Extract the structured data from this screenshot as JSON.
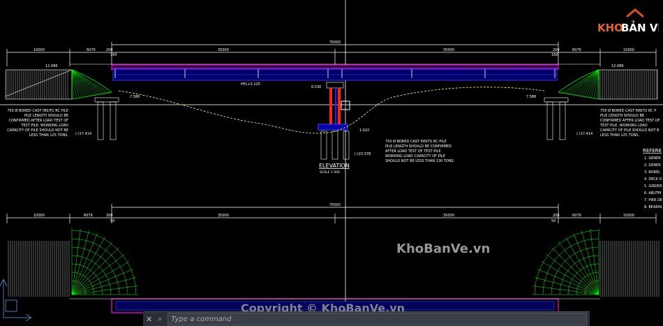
{
  "logo": {
    "brand_left": "KHO",
    "brand_right": "BẢN VẼ"
  },
  "watermarks": {
    "center": "KhoBanVe.vn",
    "copyright": "Copyright © KhoBanVe.vn"
  },
  "commandline": {
    "placeholder": "Type a command",
    "close_label": "✕",
    "search_label": "⌕"
  },
  "dims_top": {
    "overall": "70000",
    "seg1": "10000",
    "seg2": "6079",
    "seg3": "200",
    "seg4": "35000",
    "seg5": "35000",
    "seg6": "200",
    "seg7": "6079",
    "seg8": "10000",
    "sub1": "160",
    "sub2": "160"
  },
  "dims_bottom": {
    "overall": "70000",
    "seg1": "10000",
    "seg2": "6079",
    "seg3": "200",
    "seg4": "35000",
    "seg5": "35000",
    "seg6": "200",
    "seg7": "6079",
    "seg8": "10000",
    "sub1": "50",
    "sub2": "50"
  },
  "levels": {
    "left_top": "12.086",
    "right_top": "12.086",
    "hfl": "HFL+5.125",
    "left_deck": "7.586",
    "right_deck": "7.586",
    "pier": "6.530",
    "pile_top": "1.622",
    "pile_tip": "(-)23.378",
    "left_tip": "(-)17.414",
    "right_tip": "(-)17.414"
  },
  "notes": {
    "left": [
      "750 Ø BORED CAST INSITU RC PILE",
      "PILE LENGTH SHOULD BE",
      "CONFIRMED  AFTER LOAD TEST OF",
      "TEST PILE.   WORKING LOAD",
      "CAPACITY OF PILE   SHOULD NOT BE",
      "LESS THAN 125 TONS."
    ],
    "center": [
      "750 Ø BORED CAST INSITU RC PILE",
      "PILE LENGTH SHOULD BE CONFIRMED",
      "AFTER LOAD TEST OF TEST PILE",
      "WORKING LOAD CAPACITY OF PILE",
      "SHOULD NOT BE LESS THAN 130 TONS."
    ],
    "right": [
      "750 Ø BORED CAST INSITU RC P",
      "PILE LENGTH SHOULD BE",
      "CONFIRMED  AFTER LOAD TEST OF",
      "TEST PILE.   WORKING LOAD",
      "CAPACITY OF PILE   SHOULD NOT B",
      "LESS THAN 125 TONS."
    ]
  },
  "title": {
    "main": "ELEVATION",
    "scale": "SCALE 1:300"
  },
  "reference": {
    "heading": "REFERE",
    "items": [
      "1. GENER",
      "2. GENER",
      "3. BOREL",
      "4. DECK D",
      "5. GIRDER",
      "6. ABUTM",
      "7. PIER DE",
      "8. BEARIN"
    ]
  },
  "colors": {
    "background": "#000000",
    "deck": "#ff00ff",
    "girder": "#0000ff",
    "pier": "#ff0000",
    "cone": "#00ff00",
    "dims": "#ffffff",
    "ground": "#ffff00"
  }
}
